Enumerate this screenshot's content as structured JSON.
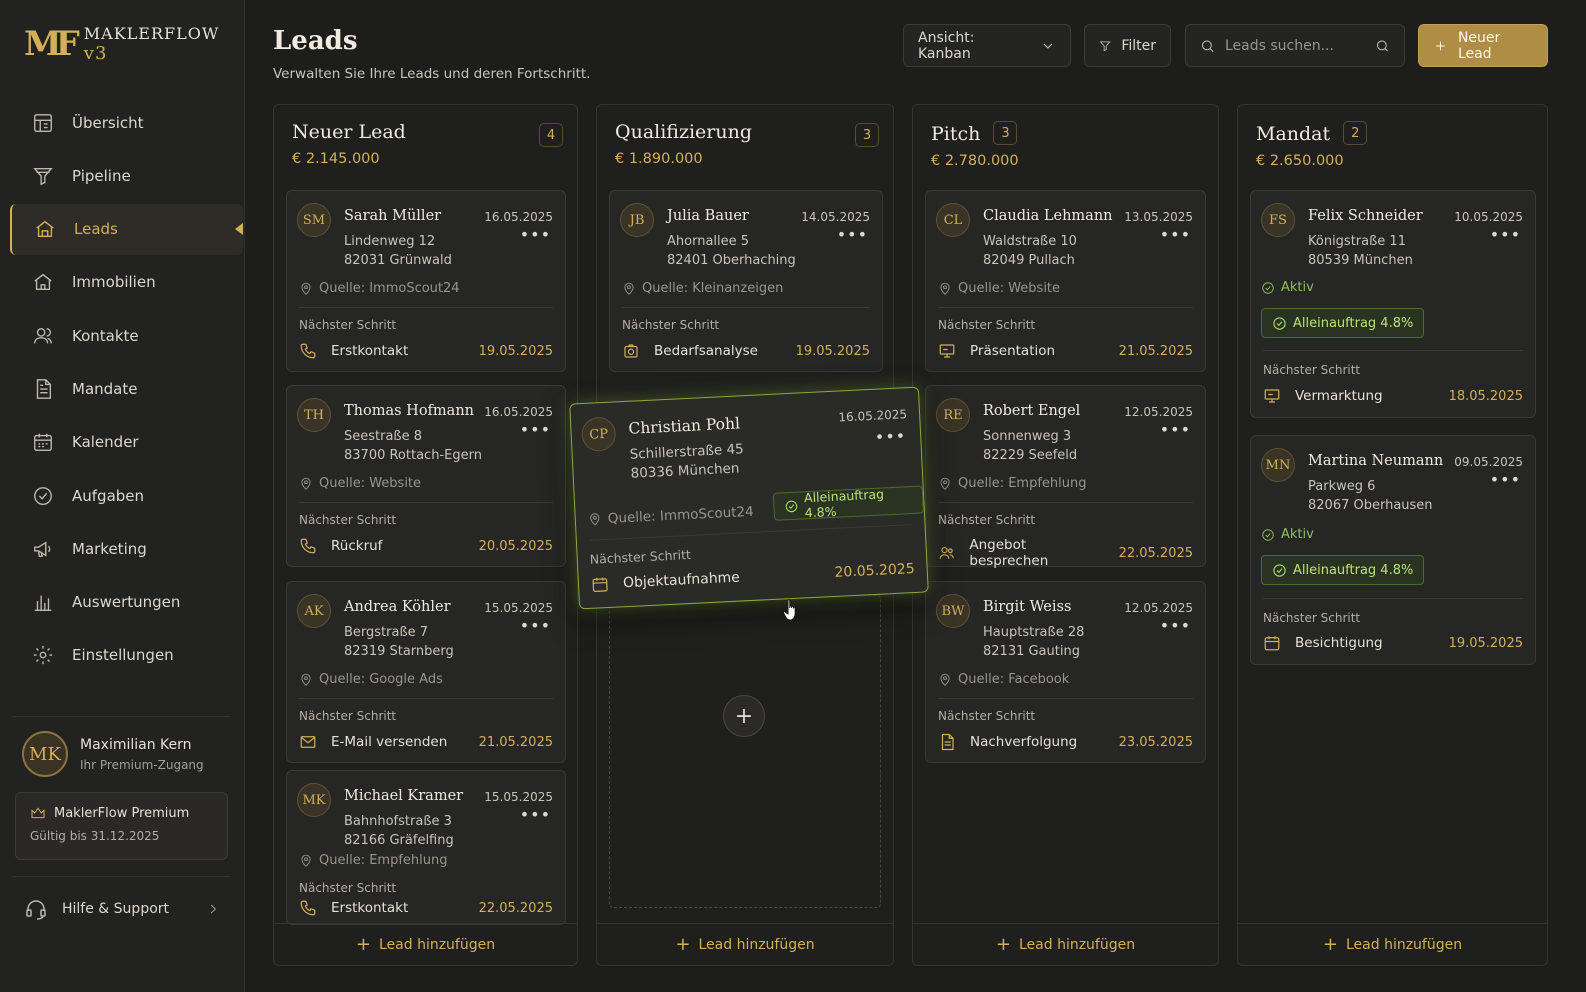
{
  "app": {
    "logo_mark": "MF",
    "logo_name": "MAKLERFLOW",
    "logo_version": "v3"
  },
  "sidebar": {
    "items": [
      {
        "label": "Übersicht",
        "icon": "dashboard-icon"
      },
      {
        "label": "Pipeline",
        "icon": "funnel-icon"
      },
      {
        "label": "Leads",
        "icon": "house-icon",
        "active": true
      },
      {
        "label": "Immobilien",
        "icon": "building-icon"
      },
      {
        "label": "Kontakte",
        "icon": "users-icon"
      },
      {
        "label": "Mandate",
        "icon": "document-icon"
      },
      {
        "label": "Kalender",
        "icon": "calendar-icon"
      },
      {
        "label": "Aufgaben",
        "icon": "check-circle-icon"
      },
      {
        "label": "Marketing",
        "icon": "megaphone-icon"
      },
      {
        "label": "Auswertungen",
        "icon": "bar-chart-icon"
      },
      {
        "label": "Einstellungen",
        "icon": "gear-icon"
      }
    ],
    "user": {
      "initials": "MK",
      "name": "Maximilian Kern",
      "subtitle": "Ihr Premium-Zugang"
    },
    "premium": {
      "title": "MaklerFlow Premium",
      "valid": "Gültig bis 31.12.2025"
    },
    "help": "Hilfe & Support"
  },
  "header": {
    "title": "Leads",
    "subtitle": "Verwalten Sie Ihre Leads und deren Fortschritt.",
    "view": "Ansicht: Kanban",
    "filter": "Filter",
    "search_placeholder": "Leads suchen...",
    "new_lead": "Neuer Lead"
  },
  "common": {
    "next_step": "Nächster Schritt",
    "add_lead": "Lead hinzufügen",
    "dots": "•••"
  },
  "columns": [
    {
      "title": "Neuer Lead",
      "count": "4",
      "sum": "€ 2.145.000",
      "cards": [
        {
          "initials": "SM",
          "name": "Sarah Müller",
          "date": "16.05.2025",
          "street": "Lindenweg 12",
          "city": "82031 Grünwald",
          "source": "Quelle: ImmoScout24",
          "next": "Erstkontakt",
          "next_date": "19.05.2025",
          "next_icon": "phone-icon"
        },
        {
          "initials": "TH",
          "name": "Thomas Hofmann",
          "date": "16.05.2025",
          "street": "Seestraße 8",
          "city": "83700 Rottach-Egern",
          "source": "Quelle: Website",
          "next": "Rückruf",
          "next_date": "20.05.2025",
          "next_icon": "phone-icon"
        },
        {
          "initials": "AK",
          "name": "Andrea Köhler",
          "date": "15.05.2025",
          "street": "Bergstraße 7",
          "city": "82319 Starnberg",
          "source": "Quelle: Google Ads",
          "next": "E-Mail versenden",
          "next_date": "21.05.2025",
          "next_icon": "mail-icon"
        },
        {
          "initials": "MK",
          "name": "Michael Kramer",
          "date": "15.05.2025",
          "street": "Bahnhofstraße 3",
          "city": "82166 Gräfelfing",
          "source": "Quelle: Empfehlung",
          "next": "Erstkontakt",
          "next_date": "22.05.2025",
          "next_icon": "phone-icon"
        }
      ]
    },
    {
      "title": "Qualifizierung",
      "count": "3",
      "sum": "€ 1.890.000",
      "cards": [
        {
          "initials": "JB",
          "name": "Julia Bauer",
          "date": "14.05.2025",
          "street": "Ahornallee 5",
          "city": "82401 Oberhaching",
          "source": "Quelle: Kleinanzeigen",
          "next": "Bedarfsanalyse",
          "next_date": "19.05.2025",
          "next_icon": "camera-icon"
        }
      ]
    },
    {
      "title": "Pitch",
      "count": "3",
      "sum": "€ 2.780.000",
      "cards": [
        {
          "initials": "CL",
          "name": "Claudia Lehmann",
          "date": "13.05.2025",
          "street": "Waldstraße 10",
          "city": "82049 Pullach",
          "source": "Quelle: Website",
          "next": "Präsentation",
          "next_date": "21.05.2025",
          "next_icon": "presentation-icon"
        },
        {
          "initials": "RE",
          "name": "Robert Engel",
          "date": "12.05.2025",
          "street": "Sonnenweg 3",
          "city": "82229 Seefeld",
          "source": "Quelle: Empfehlung",
          "next": "Angebot besprechen",
          "next_date": "22.05.2025",
          "next_icon": "users-icon"
        },
        {
          "initials": "BW",
          "name": "Birgit Weiss",
          "date": "12.05.2025",
          "street": "Hauptstraße 28",
          "city": "82131 Gauting",
          "source": "Quelle: Facebook",
          "next": "Nachverfolgung",
          "next_date": "23.05.2025",
          "next_icon": "document-icon"
        }
      ]
    },
    {
      "title": "Mandat",
      "count": "2",
      "sum": "€ 2.650.000",
      "cards": [
        {
          "initials": "FS",
          "name": "Felix Schneider",
          "date": "10.05.2025",
          "street": "Königstraße 11",
          "city": "80539 München",
          "status": "Aktiv",
          "badge": "Alleinauftrag 4.8%",
          "next": "Vermarktung",
          "next_date": "18.05.2025",
          "next_icon": "presentation-icon"
        },
        {
          "initials": "MN",
          "name": "Martina Neumann",
          "date": "09.05.2025",
          "street": "Parkweg 6",
          "city": "82067 Oberhausen",
          "status": "Aktiv",
          "badge": "Alleinauftrag 4.8%",
          "next": "Besichtigung",
          "next_date": "19.05.2025",
          "next_icon": "calendar-icon"
        }
      ]
    }
  ],
  "dragging": {
    "initials": "CP",
    "name": "Christian Pohl",
    "date": "16.05.2025",
    "street": "Schillerstraße 45",
    "city": "80336 München",
    "source": "Quelle: ImmoScout24",
    "badge": "Alleinauftrag 4.8%",
    "next": "Objektaufnahme",
    "next_date": "20.05.2025",
    "next_icon": "calendar-icon"
  },
  "dropzone_plus": "+",
  "colors": {
    "gold": "#d4af5a",
    "green": "#8fbf5a",
    "bg": "#1d1d1c"
  }
}
